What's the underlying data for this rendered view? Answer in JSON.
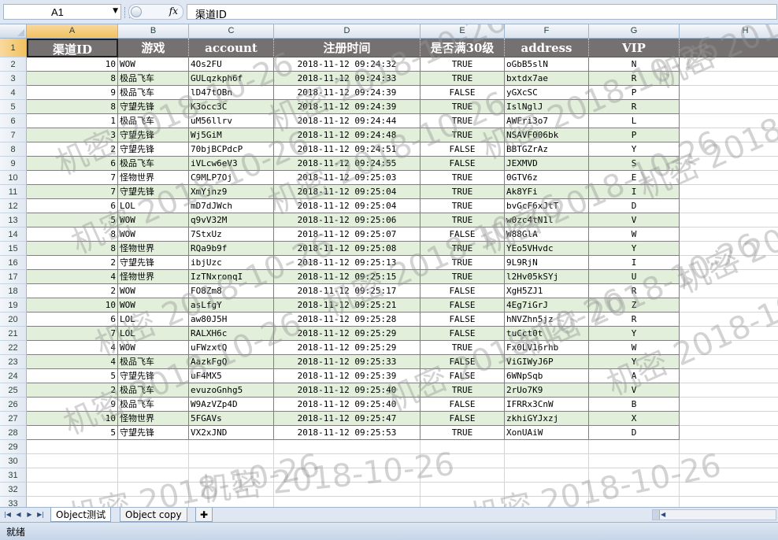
{
  "formula_bar": {
    "name_box": "A1",
    "fx_label": "fx",
    "content": "渠道ID"
  },
  "columns": [
    "A",
    "B",
    "C",
    "D",
    "E",
    "F",
    "G",
    "H"
  ],
  "headers": [
    "渠道ID",
    "游戏",
    "account",
    "注册时间",
    "是否满30级",
    "address",
    "VIP"
  ],
  "rows": [
    [
      "10",
      "WOW",
      "4Os2FU",
      "2018-11-12 09:24:32",
      "TRUE",
      "oGbB5slN",
      "N"
    ],
    [
      "8",
      "极品飞车",
      "GULqzkph6f",
      "2018-11-12 09:24:33",
      "TRUE",
      "bxtdx7ae",
      "R"
    ],
    [
      "9",
      "极品飞车",
      "lD47tOBn",
      "2018-11-12 09:24:39",
      "FALSE",
      "yGXcSC",
      "P"
    ],
    [
      "8",
      "守望先锋",
      "K3occ3C",
      "2018-11-12 09:24:39",
      "TRUE",
      "IslNglJ",
      "R"
    ],
    [
      "1",
      "极品飞车",
      "uM56llrv",
      "2018-11-12 09:24:44",
      "TRUE",
      "AWFri3o7",
      "L"
    ],
    [
      "3",
      "守望先锋",
      "Wj5GiM",
      "2018-11-12 09:24:48",
      "TRUE",
      "NSAVF006bk",
      "P"
    ],
    [
      "2",
      "守望先锋",
      "70bjBCPdcP",
      "2018-11-12 09:24:51",
      "FALSE",
      "BBTGZrAz",
      "Y"
    ],
    [
      "6",
      "极品飞车",
      "iVLcw6eV3",
      "2018-11-12 09:24:55",
      "FALSE",
      "JEXMVD",
      "S"
    ],
    [
      "7",
      "怪物世界",
      "C9MLP7Oj",
      "2018-11-12 09:25:03",
      "TRUE",
      "0GTV6z",
      "E"
    ],
    [
      "7",
      "守望先锋",
      "XmYjnz9",
      "2018-11-12 09:25:04",
      "TRUE",
      "Ak8YFi",
      "I"
    ],
    [
      "6",
      "LOL",
      "mD7dJWch",
      "2018-11-12 09:25:04",
      "TRUE",
      "bvGcF6xJtT",
      "D"
    ],
    [
      "5",
      "WOW",
      "q9vV32M",
      "2018-11-12 09:25:06",
      "TRUE",
      "w0zc4tN1l",
      "V"
    ],
    [
      "8",
      "WOW",
      "7StxUz",
      "2018-11-12 09:25:07",
      "FALSE",
      "W88GlA",
      "W"
    ],
    [
      "8",
      "怪物世界",
      "RQa9b9f",
      "2018-11-12 09:25:08",
      "TRUE",
      "YEo5VHvdc",
      "Y"
    ],
    [
      "2",
      "守望先锋",
      "ibjUzc",
      "2018-11-12 09:25:13",
      "TRUE",
      "9L9RjN",
      "I"
    ],
    [
      "4",
      "怪物世界",
      "IzTNxronqI",
      "2018-11-12 09:25:15",
      "TRUE",
      "l2Hv05kSYj",
      "U"
    ],
    [
      "2",
      "WOW",
      "FO8Zm8",
      "2018-11-12 09:25:17",
      "FALSE",
      "XgH5ZJ1",
      "R"
    ],
    [
      "10",
      "WOW",
      "asLfgY",
      "2018-11-12 09:25:21",
      "FALSE",
      "4Eg7iGrJ",
      "Z"
    ],
    [
      "6",
      "LOL",
      "aw80J5H",
      "2018-11-12 09:25:28",
      "FALSE",
      "hNVZhn5jz",
      "R"
    ],
    [
      "7",
      "LOL",
      "RALXH6c",
      "2018-11-12 09:25:29",
      "FALSE",
      "tuCct0t",
      "Y"
    ],
    [
      "4",
      "WOW",
      "uFWzxtQ",
      "2018-11-12 09:25:29",
      "TRUE",
      "Fx0LV16rhb",
      "W"
    ],
    [
      "4",
      "极品飞车",
      "AazkFgQ",
      "2018-11-12 09:25:33",
      "FALSE",
      "ViGIWyJ6P",
      "Y"
    ],
    [
      "5",
      "守望先锋",
      "uF4MX5",
      "2018-11-12 09:25:39",
      "FALSE",
      "6WNpSqb",
      "A"
    ],
    [
      "2",
      "极品飞车",
      "evuzoGnhg5",
      "2018-11-12 09:25:40",
      "TRUE",
      "2rUo7K9",
      "V"
    ],
    [
      "9",
      "极品飞车",
      "W9AzVZp4D",
      "2018-11-12 09:25:40",
      "FALSE",
      "IFRRx3CnW",
      "B"
    ],
    [
      "10",
      "怪物世界",
      "5FGAVs",
      "2018-11-12 09:25:47",
      "FALSE",
      "zkhiGYJxzj",
      "X"
    ],
    [
      "5",
      "守望先锋",
      "VX2xJND",
      "2018-11-12 09:25:53",
      "TRUE",
      "XonUAiW",
      "D"
    ]
  ],
  "empty_row_numbers": [
    "29",
    "30",
    "31",
    "32",
    "33"
  ],
  "watermark": "机密 2018-10-26",
  "sheet_tabs": [
    "Object测试",
    "Object copy"
  ],
  "status_text": "就绪",
  "colors": {
    "header_bg": "#767171",
    "band_bg": "#e2efda",
    "selection": "#f1c15f"
  }
}
